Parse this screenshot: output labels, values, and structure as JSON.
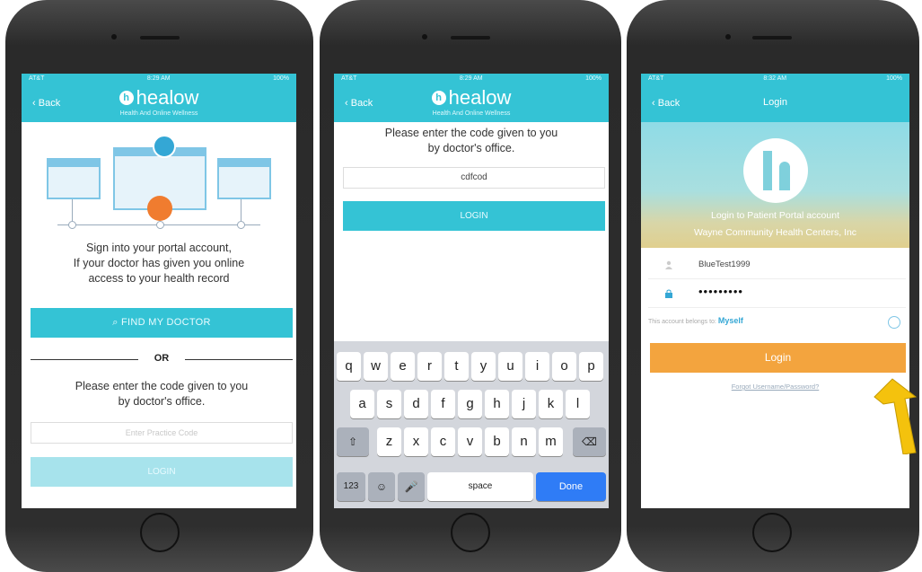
{
  "status": {
    "carrier": "AT&T",
    "time1": "8:29 AM",
    "time2": "8:29 AM",
    "time3": "8:32 AM",
    "battery": "100%"
  },
  "header": {
    "back": "Back",
    "app_name": "healow",
    "tagline": "Health And Online Wellness",
    "login_title": "Login"
  },
  "screen1": {
    "signin_line1": "Sign into your portal account,",
    "signin_line2": "If your doctor has given you online",
    "signin_line3": "access to your health record",
    "find_doctor": "FIND MY DOCTOR",
    "or": "OR",
    "enter_line1": "Please enter the code given to you",
    "enter_line2": "by doctor's office.",
    "practice_placeholder": "Enter Practice Code",
    "login": "LOGIN"
  },
  "screen2": {
    "enter_line1": "Please enter the code given to you",
    "enter_line2": "by doctor's office.",
    "code_value": "cdfcod",
    "login": "LOGIN",
    "keyboard": {
      "row1": [
        "q",
        "w",
        "e",
        "r",
        "t",
        "y",
        "u",
        "i",
        "o",
        "p"
      ],
      "row2": [
        "a",
        "s",
        "d",
        "f",
        "g",
        "h",
        "j",
        "k",
        "l"
      ],
      "row3": [
        "z",
        "x",
        "c",
        "v",
        "b",
        "n",
        "m"
      ],
      "shift": "⇧",
      "backspace": "⌫",
      "numbers": "123",
      "emoji": "☺",
      "mic": "🎤",
      "space": "space",
      "done": "Done"
    }
  },
  "screen3": {
    "hero_line1": "Login to Patient Portal account",
    "hero_line2": "Wayne Community Health Centers, Inc",
    "username": "BlueTest1999",
    "password": "•••••••••",
    "account_label": "This account belongs to:",
    "account_value": "Myself",
    "login": "Login",
    "forgot": "Forgot Username/Password?"
  },
  "colors": {
    "brand": "#34c3d5",
    "login_orange": "#f3a43e",
    "keyboard_blue": "#2f7cf6"
  }
}
